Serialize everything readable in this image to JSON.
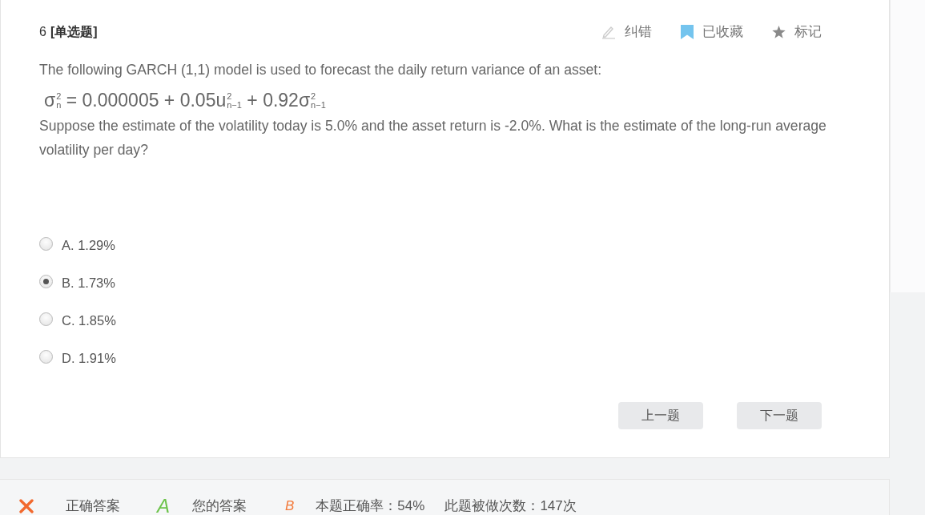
{
  "question": {
    "number": "6",
    "type": "[单选题]",
    "actions": [
      {
        "kind": "report",
        "label": "纠错",
        "active": false
      },
      {
        "kind": "favorite",
        "label": "已收藏",
        "active": true
      },
      {
        "kind": "mark",
        "label": "标记",
        "active": false
      }
    ],
    "intro": "The following GARCH (1,1) model is used to forecast the daily return variance of an asset:",
    "formula": [
      {
        "text": "σ",
        "sup": "2",
        "sub": "n"
      },
      {
        "text": " = 0.000005 + 0.05u",
        "sup": "2",
        "sub": "n−1"
      },
      {
        "text": " + 0.92σ",
        "sup": "2",
        "sub": "n−1"
      }
    ],
    "prompt": "Suppose the estimate of the volatility today is 5.0% and the asset return is -2.0%. What is the estimate of the long-run average volatility per day?",
    "options": [
      {
        "label": "A. 1.29%",
        "selected": false
      },
      {
        "label": "B. 1.73%",
        "selected": true
      },
      {
        "label": "C. 1.85%",
        "selected": false
      },
      {
        "label": "D. 1.91%",
        "selected": false
      }
    ],
    "buttons": [
      "上一题",
      "下一题"
    ]
  },
  "result_bar": {
    "result": {
      "correct": false
    },
    "correct_answer": {
      "label": "正确答案",
      "value": "A"
    },
    "your_answer": {
      "label": "您的答案",
      "value": "B"
    },
    "accuracy": "本题正确率：54%",
    "attempts": "此题被做次数：147次"
  }
}
